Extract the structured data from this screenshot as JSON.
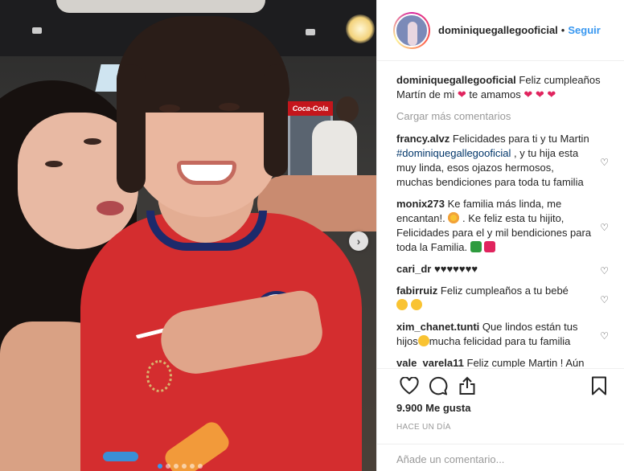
{
  "post": {
    "username": "dominiquegallegooficial",
    "bullet": "•",
    "follow_label": "Seguir",
    "caption_text_1": "Feliz cumpleaños Martín de mi",
    "caption_text_2": "te amamos",
    "load_more": "Cargar más comentarios",
    "fridge_brand": "Coca-Cola"
  },
  "comments": [
    {
      "user": "francy.alvz",
      "text_1": "Felicidades para ti y tu Martin",
      "tag": "#dominiquegallegooficial",
      "text_2": ", y tu hija esta muy linda, esos ojazos hermosos, muchas bendiciones para toda tu familia"
    },
    {
      "user": "monix273",
      "text_1": "Ke familia más linda, me encantan!.",
      "text_2": ". Ke feliz esta tu hijito, Felicidades para el y mil bendiciones para toda la Familia."
    },
    {
      "user": "cari_dr",
      "text": "♥♥♥♥♥♥♥"
    },
    {
      "user": "fabirruiz",
      "text": "Feliz cumpleaños a tu bebé"
    },
    {
      "user": "xim_chanet.tunti",
      "text_1": "Que lindos están tus hijos",
      "text_2": "mucha felicidad para tu familia"
    },
    {
      "user": "vale_varela11",
      "text": "Feliz cumple Martin ! Aún"
    }
  ],
  "stats": {
    "likes": "9.900 Me gusta",
    "time": "HACE UN DÍA"
  },
  "compose": {
    "placeholder": "Añade un comentario..."
  },
  "carousel": {
    "next": "›",
    "count": 6,
    "active": 0
  },
  "icons": [
    "heart-icon",
    "comment-icon",
    "share-icon",
    "bookmark-icon",
    "next-arrow-icon"
  ],
  "colors": {
    "link": "#3897f0",
    "tag": "#003569",
    "muted": "#999999",
    "like_red": "#e0245e"
  }
}
